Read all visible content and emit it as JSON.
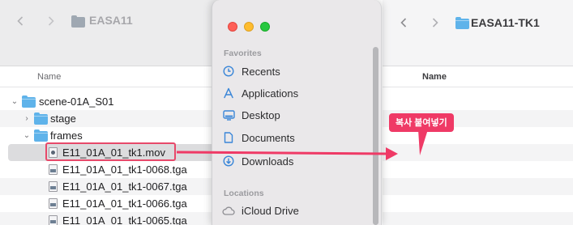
{
  "left_window": {
    "title": "EASA11",
    "column_name": "Name",
    "tree": [
      {
        "label": "scene-01A_S01",
        "chevron": "⌄"
      },
      {
        "label": "stage",
        "chevron": "›"
      },
      {
        "label": "frames",
        "chevron": "⌄"
      },
      {
        "label": "E11_01A_01_tk1.mov"
      },
      {
        "label": "E11_01A_01_tk1-0068.tga"
      },
      {
        "label": "E11_01A_01_tk1-0067.tga"
      },
      {
        "label": "E11_01A_01_tk1-0066.tga"
      },
      {
        "label": "E11_01A_01_tk1-0065.tga"
      }
    ]
  },
  "sidebar": {
    "favorites_label": "Favorites",
    "items": [
      {
        "label": "Recents",
        "icon": "clock-icon"
      },
      {
        "label": "Applications",
        "icon": "applications-icon"
      },
      {
        "label": "Desktop",
        "icon": "desktop-icon"
      },
      {
        "label": "Documents",
        "icon": "document-icon"
      },
      {
        "label": "Downloads",
        "icon": "download-icon"
      }
    ],
    "locations_label": "Locations",
    "location_items": [
      {
        "label": "iCloud Drive",
        "icon": "cloud-icon"
      }
    ]
  },
  "right_window": {
    "title": "EASA11-TK1",
    "column_name": "Name"
  },
  "annotation": {
    "callout": "복사 붙여넣기"
  },
  "colors": {
    "accent": "#ef3a66",
    "folder_blue": "#5fb3ea",
    "sidebar_icon": "#3a86d8"
  }
}
